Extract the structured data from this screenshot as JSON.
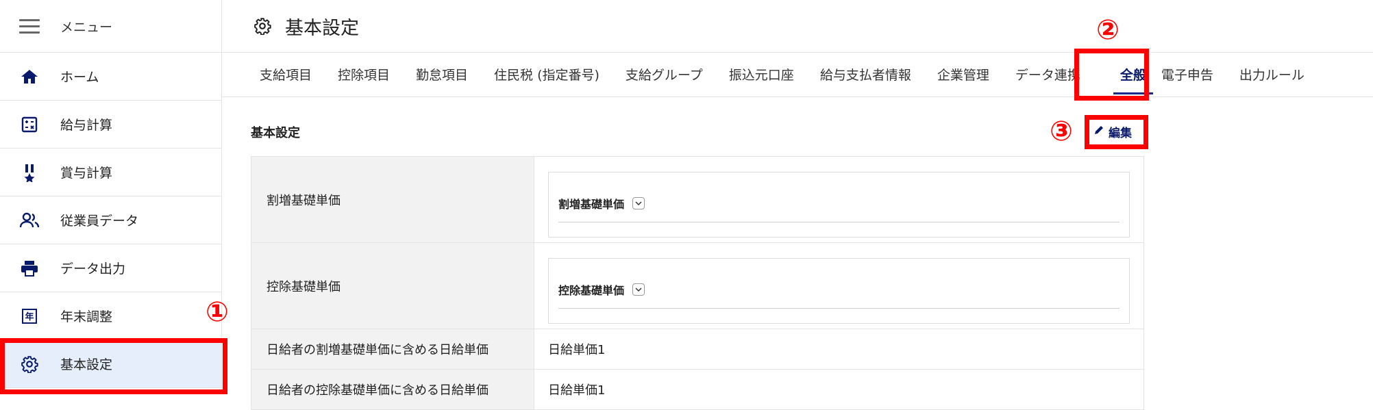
{
  "sidebar": {
    "menu_label": "メニュー",
    "items": [
      {
        "label": "ホーム",
        "icon": "home-icon"
      },
      {
        "label": "給与計算",
        "icon": "calculator-icon"
      },
      {
        "label": "賞与計算",
        "icon": "award-icon"
      },
      {
        "label": "従業員データ",
        "icon": "people-icon"
      },
      {
        "label": "データ出力",
        "icon": "printer-icon"
      },
      {
        "label": "年末調整",
        "icon": "year-icon",
        "icon_text": "年"
      },
      {
        "label": "基本設定",
        "icon": "gear-icon",
        "active": true
      }
    ]
  },
  "header": {
    "title": "基本設定",
    "icon": "gear-icon"
  },
  "tabs": [
    {
      "label": "支給項目"
    },
    {
      "label": "控除項目"
    },
    {
      "label": "勤怠項目"
    },
    {
      "label": "住民税 (指定番号)"
    },
    {
      "label": "支給グループ"
    },
    {
      "label": "振込元口座"
    },
    {
      "label": "給与支払者情報"
    },
    {
      "label": "企業管理"
    },
    {
      "label": "データ連携"
    },
    {
      "label": "全般",
      "active": true
    },
    {
      "label": "電子申告"
    },
    {
      "label": "出力ルール"
    }
  ],
  "section": {
    "title": "基本設定",
    "edit_label": "編集"
  },
  "rows": [
    {
      "label": "割増基礎単価",
      "card_label": "割増基礎単価"
    },
    {
      "label": "控除基礎単価",
      "card_label": "控除基礎単価"
    },
    {
      "label": "日給者の割増基礎単価に含める日給単価",
      "value": "日給単価1"
    },
    {
      "label": "日給者の控除基礎単価に含める日給単価",
      "value": "日給単価1"
    }
  ],
  "annotations": [
    "①",
    "②",
    "③"
  ],
  "colors": {
    "accent": "#0a1a6b",
    "annotation": "#ff0000",
    "active_bg": "#e6eefb"
  }
}
